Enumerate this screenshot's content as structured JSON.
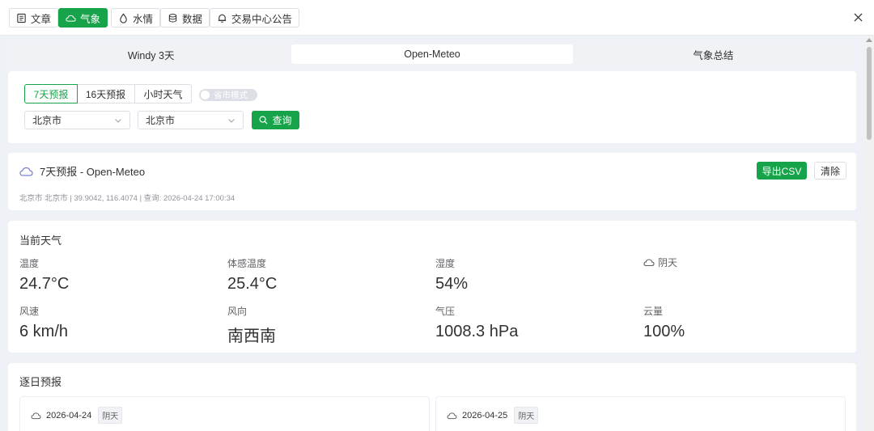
{
  "nav": {
    "items": [
      {
        "label": "文章",
        "icon": "article-icon"
      },
      {
        "label": "气象",
        "icon": "cloud-icon"
      },
      {
        "label": "水情",
        "icon": "water-drop-icon"
      },
      {
        "label": "数据",
        "icon": "database-icon"
      },
      {
        "label": "交易中心公告",
        "icon": "bell-icon"
      }
    ],
    "active": "气象"
  },
  "tabs": [
    {
      "label": "Windy 3天"
    },
    {
      "label": "Open-Meteo"
    },
    {
      "label": "气象总结"
    }
  ],
  "active_tab": "Open-Meteo",
  "query": {
    "modes": [
      {
        "label": "7天预报"
      },
      {
        "label": "16天预报"
      },
      {
        "label": "小时天气"
      }
    ],
    "active_mode": "7天预报",
    "toggle_label": "省市模式",
    "province": "北京市",
    "city": "北京市",
    "query_label": "查询"
  },
  "result": {
    "title": "7天预报 - Open-Meteo",
    "meta": "北京市 北京市 | 39.9042, 116.4074 | 查询: 2026-04-24 17:00:34",
    "export_label": "导出CSV",
    "clear_label": "清除"
  },
  "current": {
    "title": "当前天气",
    "temperature": {
      "label": "温度",
      "value": "24.7°C"
    },
    "feels_like": {
      "label": "体感温度",
      "value": "25.4°C"
    },
    "humidity": {
      "label": "湿度",
      "value": "54%"
    },
    "condition": {
      "label": "阴天"
    },
    "wind_speed": {
      "label": "风速",
      "value": "6 km/h"
    },
    "wind_direction": {
      "label": "风向",
      "value": "南西南"
    },
    "pressure": {
      "label": "气压",
      "value": "1008.3 hPa"
    },
    "cloud_cover": {
      "label": "云量",
      "value": "100%"
    }
  },
  "daily": {
    "title": "逐日预报",
    "days": [
      {
        "date": "2026-04-24",
        "condition": "阴天"
      },
      {
        "date": "2026-04-25",
        "condition": "阴天"
      }
    ]
  },
  "colors": {
    "accent": "#16a34a",
    "page_bg": "#eef1f5",
    "border": "#dcdfe6"
  }
}
